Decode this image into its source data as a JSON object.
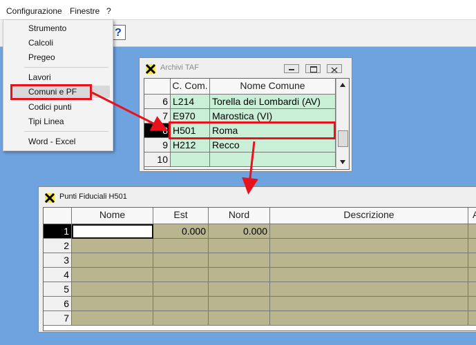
{
  "menubar": {
    "items": [
      "Configurazione",
      "Finestre",
      "?"
    ]
  },
  "toolbar": {
    "help_label": "?"
  },
  "dropdown": {
    "items": [
      "Strumento",
      "Calcoli",
      "Pregeo",
      "Lavori",
      "Comuni e PF",
      "Codici punti",
      "Tipi Linea",
      "Word - Excel"
    ],
    "highlighted": "Comuni e PF"
  },
  "taf": {
    "title": "Archivi TAF",
    "headers": [
      "C. Com.",
      "Nome Comune"
    ],
    "rows": [
      {
        "n": "6",
        "code": "L214",
        "name": "Torella dei Lombardi (AV)"
      },
      {
        "n": "7",
        "code": "E970",
        "name": "Marostica (VI)"
      },
      {
        "n": "8",
        "code": "H501",
        "name": "Roma"
      },
      {
        "n": "9",
        "code": "H212",
        "name": "Recco"
      },
      {
        "n": "10",
        "code": "",
        "name": ""
      }
    ],
    "selected_row": "8"
  },
  "pf": {
    "title": "Punti Fiduciali H501",
    "headers": [
      "Nome",
      "Est",
      "Nord",
      "Descrizione",
      "A"
    ],
    "rows": [
      {
        "n": "1",
        "nome": "",
        "est": "0.000",
        "nord": "0.000",
        "desc": ""
      },
      {
        "n": "2"
      },
      {
        "n": "3"
      },
      {
        "n": "4"
      },
      {
        "n": "5"
      },
      {
        "n": "6"
      },
      {
        "n": "7"
      }
    ]
  },
  "colors": {
    "desktop": "#6fa3e0",
    "annotation": "#e8121c",
    "grid_green": "#c9efd6",
    "grid_olive": "#b8b58f"
  },
  "icons": [
    "app-logo-icon",
    "minimize-icon",
    "restore-icon",
    "close-icon",
    "scroll-up-icon",
    "scroll-down-icon"
  ]
}
